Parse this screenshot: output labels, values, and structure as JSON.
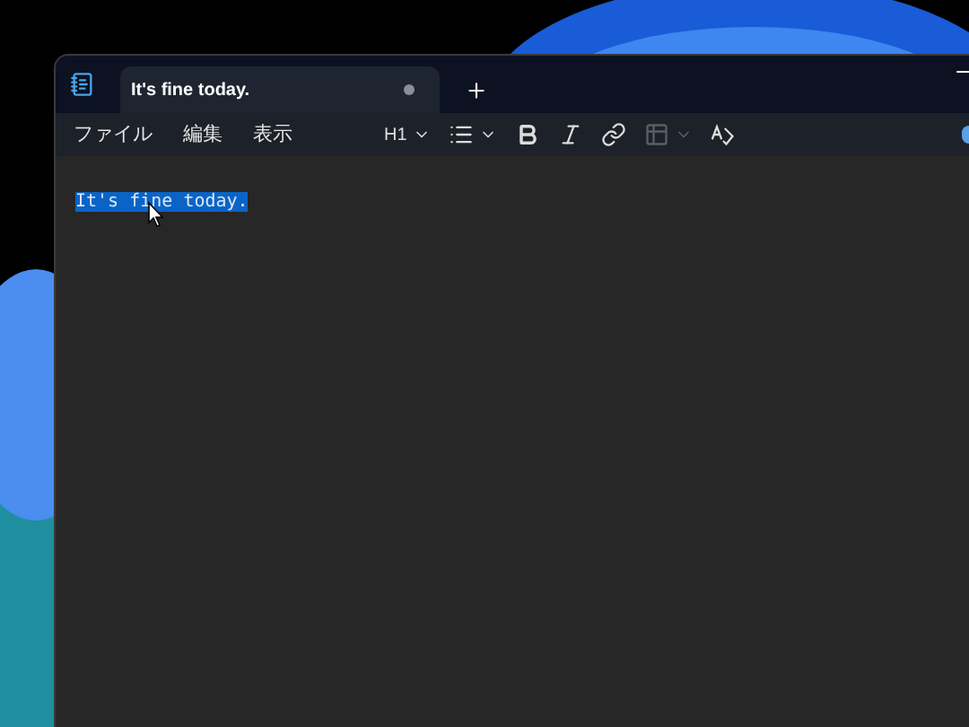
{
  "tab": {
    "title": "It's fine today.",
    "unsaved": true,
    "selected": true
  },
  "menu": [
    "ファイル",
    "編集",
    "表示"
  ],
  "toolbar": [
    {
      "kind": "heading",
      "label": "H1",
      "disabled": false
    },
    {
      "kind": "list",
      "disabled": false
    },
    {
      "kind": "bold",
      "disabled": false
    },
    {
      "kind": "italic",
      "disabled": false
    },
    {
      "kind": "link",
      "disabled": false
    },
    {
      "kind": "table",
      "disabled": true
    },
    {
      "kind": "spellcheck",
      "disabled": false
    }
  ],
  "document": {
    "text": "It's fine today.",
    "selected": true
  }
}
